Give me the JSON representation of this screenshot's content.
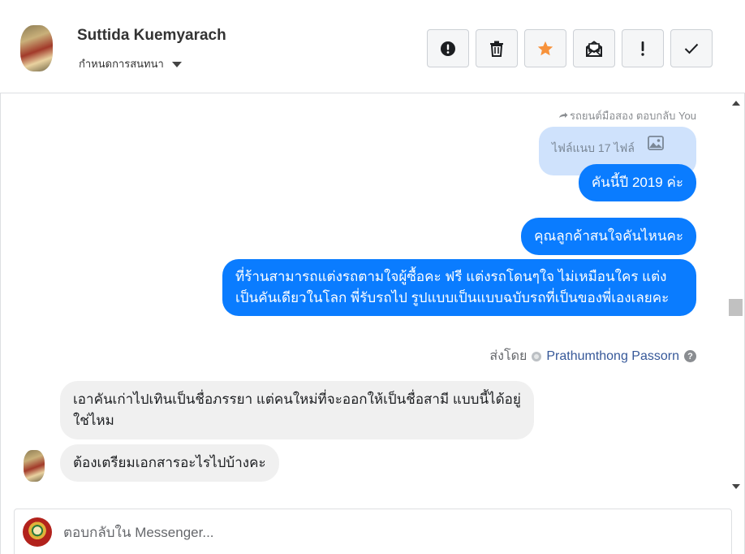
{
  "header": {
    "contact_name": "Suttida Kuemyarach",
    "conversation_settings_label": "กำหนดการสนทนา",
    "actions": [
      {
        "name": "mark-spam",
        "icon": "alert-circle-icon"
      },
      {
        "name": "delete",
        "icon": "trash-icon"
      },
      {
        "name": "star",
        "icon": "star-icon",
        "color": "#f7923b"
      },
      {
        "name": "mark-unread",
        "icon": "envelope-open-icon"
      },
      {
        "name": "follow-up",
        "icon": "exclamation-icon"
      },
      {
        "name": "done",
        "icon": "checkmark-icon"
      }
    ]
  },
  "thread": {
    "reply_note": "รถยนต์มือสอง ตอบกลับ You",
    "attachment_label": "ไฟล์แนบ 17 ไฟล์",
    "messages": [
      {
        "direction": "out",
        "text": "คันนี้ปี 2019 ค่ะ"
      },
      {
        "direction": "out",
        "text": "คุณลูกค้าสนใจคันไหนคะ"
      },
      {
        "direction": "out",
        "text": "ที่ร้านสามารถแต่งรถตามใจผู้ซื้อคะ ฟรี แต่งรถโดนๆใจ ไม่เหมือนใคร แต่งเป็นคันเดียวในโลก พี่รับรถไป รูปแบบเป็นแบบฉบับรถที่เป็นของพี่เองเลยคะ"
      },
      {
        "direction": "in",
        "text": "เอาคันเก่าไปเทินเป็นชื่อภรรยา แต่คนใหม่ที่จะออกให้เป็นชื่อสามี แบบนี้ได้อยู่ใช่ไหม"
      },
      {
        "direction": "in",
        "text": "ต้องเตรียมเอกสารอะไรไปบ้างคะ"
      }
    ],
    "sent_by_label": "ส่งโดย",
    "sent_by_name": "Prathumthong Passorn",
    "help_symbol": "?"
  },
  "composer": {
    "placeholder": "ตอบกลับใน Messenger...",
    "value": ""
  },
  "colors": {
    "outgoing_bubble": "#0a7cff",
    "incoming_bubble": "#f0f0f0",
    "attachment_bubble": "#cfe2fc",
    "star": "#f7923b"
  }
}
